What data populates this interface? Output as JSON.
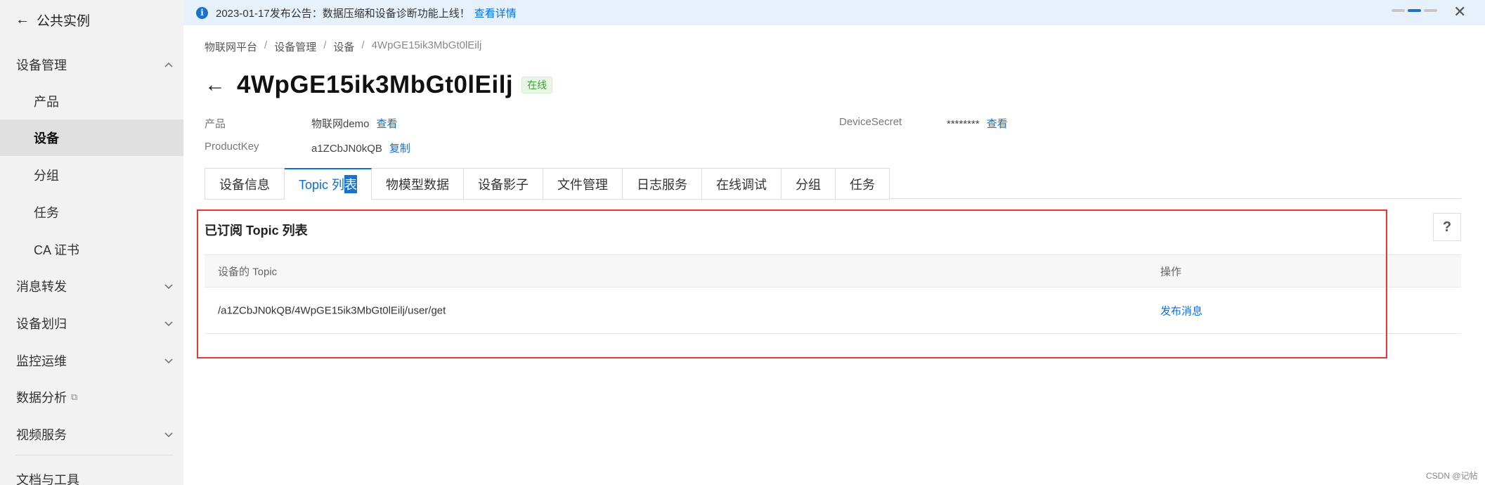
{
  "sidebar": {
    "back_label": "公共实例",
    "groups": [
      {
        "label": "设备管理",
        "expanded": true
      },
      {
        "label": "消息转发"
      },
      {
        "label": "设备划归"
      },
      {
        "label": "监控运维"
      },
      {
        "label": "数据分析"
      },
      {
        "label": "视频服务"
      },
      {
        "label": "文档与工具"
      }
    ],
    "sub_items": [
      "产品",
      "设备",
      "分组",
      "任务",
      "CA 证书"
    ],
    "active_sub": "设备"
  },
  "notice": {
    "text": "2023-01-17发布公告：数据压缩和设备诊断功能上线！",
    "link": "查看详情"
  },
  "breadcrumb": [
    "物联网平台",
    "设备管理",
    "设备",
    "4WpGE15ik3MbGt0lEilj"
  ],
  "device": {
    "name": "4WpGE15ik3MbGt0lEilj",
    "status": "在线",
    "product_label": "产品",
    "product_value": "物联网demo",
    "product_link": "查看",
    "productkey_label": "ProductKey",
    "productkey_value": "a1ZCbJN0kQB",
    "productkey_link": "复制",
    "secret_label": "DeviceSecret",
    "secret_value": "********",
    "secret_link": "查看"
  },
  "tabs": {
    "t1": "设备信息",
    "t2a": "Topic 列",
    "t2b": "表",
    "t3": "物模型数据",
    "t4": "设备影子",
    "t5": "文件管理",
    "t6": "日志服务",
    "t7": "在线调试",
    "t8": "分组",
    "t9": "任务",
    "active": "Topic 列表"
  },
  "section": {
    "title": "已订阅 Topic 列表",
    "help": "?"
  },
  "table": {
    "headers": [
      "设备的 Topic",
      "操作"
    ],
    "rows": [
      {
        "topic": "/a1ZCbJN0kQB/4WpGE15ik3MbGt0lEilj/user/get",
        "action": "发布消息"
      }
    ]
  },
  "watermark": "CSDN @记帖",
  "colors": {
    "accent": "#0a6fd6",
    "highlight_box": "#e53935",
    "online": "#3f9f3f"
  }
}
